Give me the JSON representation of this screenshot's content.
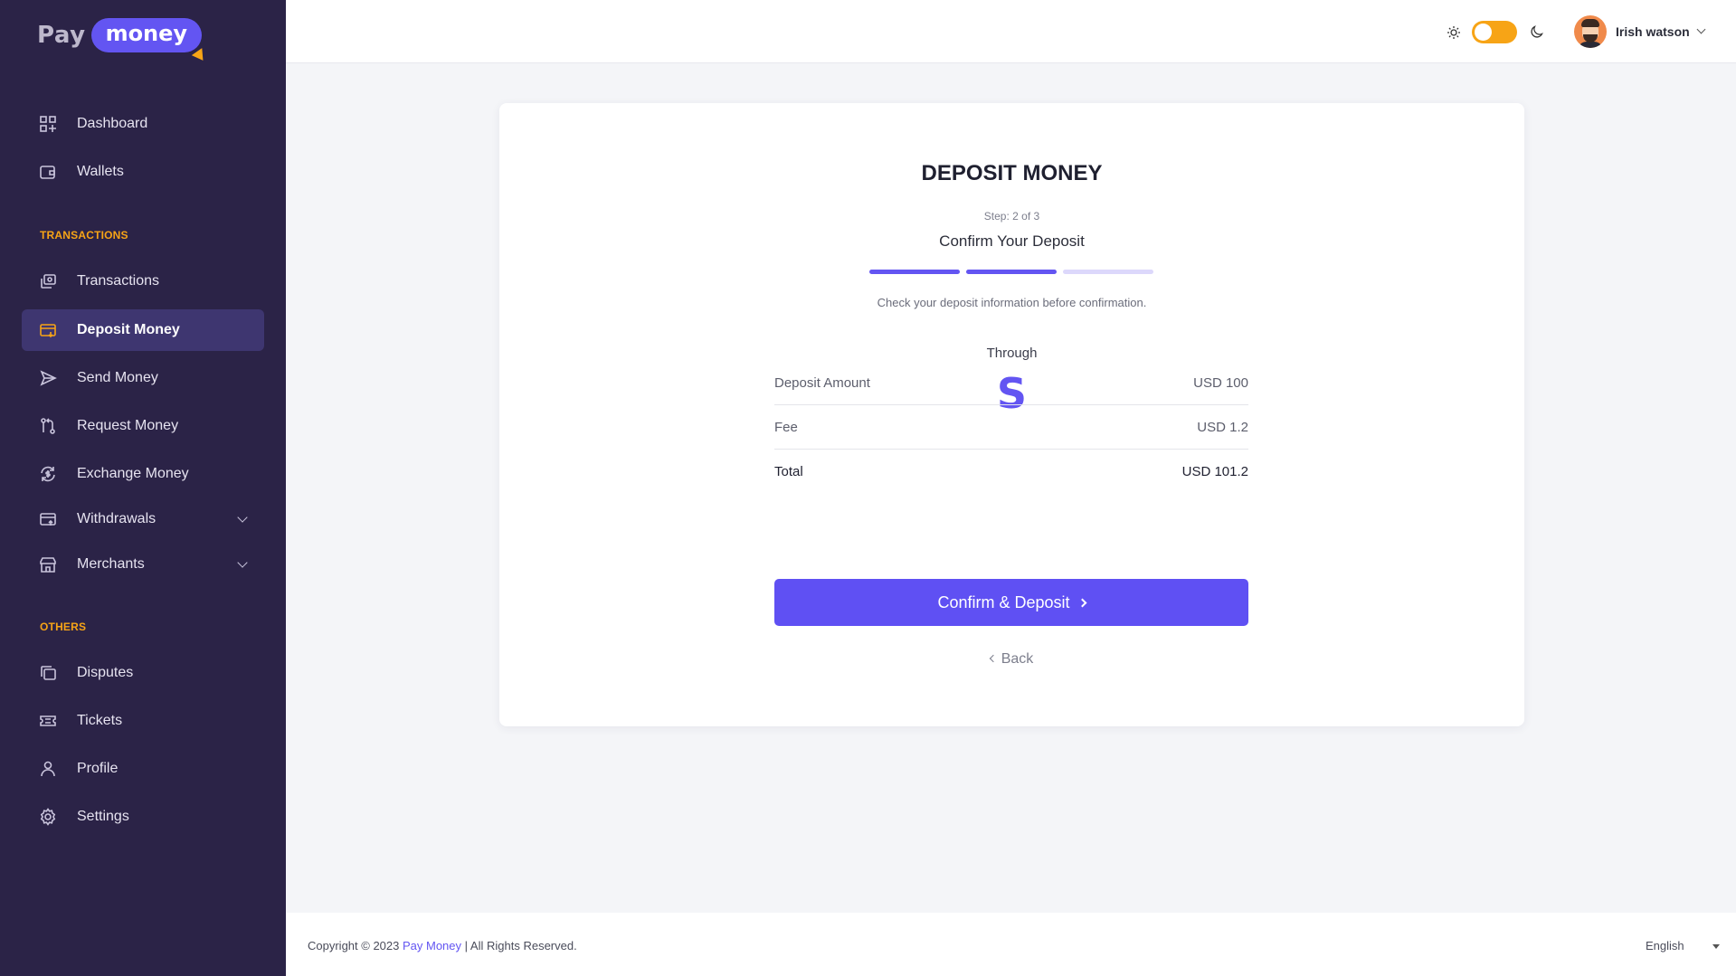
{
  "brand": {
    "logo_left": "Pay",
    "logo_right": "money"
  },
  "sidebar": {
    "items_top": [
      {
        "label": "Dashboard",
        "icon": "dashboard-icon"
      },
      {
        "label": "Wallets",
        "icon": "wallet-icon"
      }
    ],
    "section_transactions": "TRANSACTIONS",
    "items_transactions": [
      {
        "label": "Transactions",
        "icon": "transactions-icon"
      },
      {
        "label": "Deposit Money",
        "icon": "deposit-icon",
        "active": true
      },
      {
        "label": "Send Money",
        "icon": "send-icon"
      },
      {
        "label": "Request Money",
        "icon": "request-icon"
      },
      {
        "label": "Exchange Money",
        "icon": "exchange-icon"
      },
      {
        "label": "Withdrawals",
        "icon": "withdrawal-icon",
        "has_submenu": true
      },
      {
        "label": "Merchants",
        "icon": "merchant-icon",
        "has_submenu": true
      }
    ],
    "section_others": "OTHERS",
    "items_others": [
      {
        "label": "Disputes",
        "icon": "disputes-icon"
      },
      {
        "label": "Tickets",
        "icon": "ticket-icon"
      },
      {
        "label": "Profile",
        "icon": "profile-icon"
      },
      {
        "label": "Settings",
        "icon": "settings-icon"
      }
    ]
  },
  "header": {
    "theme_toggle": "light",
    "user_name": "Irish watson"
  },
  "deposit": {
    "title": "DEPOSIT MONEY",
    "step": "Step: 2 of 3",
    "step_title": "Confirm Your Deposit",
    "progress": {
      "current": 2,
      "total": 3
    },
    "hint": "Check your deposit information before confirmation.",
    "through_label": "Through",
    "gateway_logo": "S",
    "rows": [
      {
        "label": "Deposit Amount",
        "value": "USD 100"
      },
      {
        "label": "Fee",
        "value": "USD 1.2"
      },
      {
        "label": "Total",
        "value": "USD 101.2"
      }
    ],
    "confirm_label": "Confirm & Deposit",
    "back_label": "Back"
  },
  "footer": {
    "copyright_prefix": "Copyright © 2023",
    "brand_link": "Pay Money",
    "copyright_suffix": "| All Rights Reserved.",
    "language": "English"
  },
  "colors": {
    "sidebar_bg": "#2b2347",
    "accent": "#6355f2",
    "highlight": "#f7a416"
  }
}
